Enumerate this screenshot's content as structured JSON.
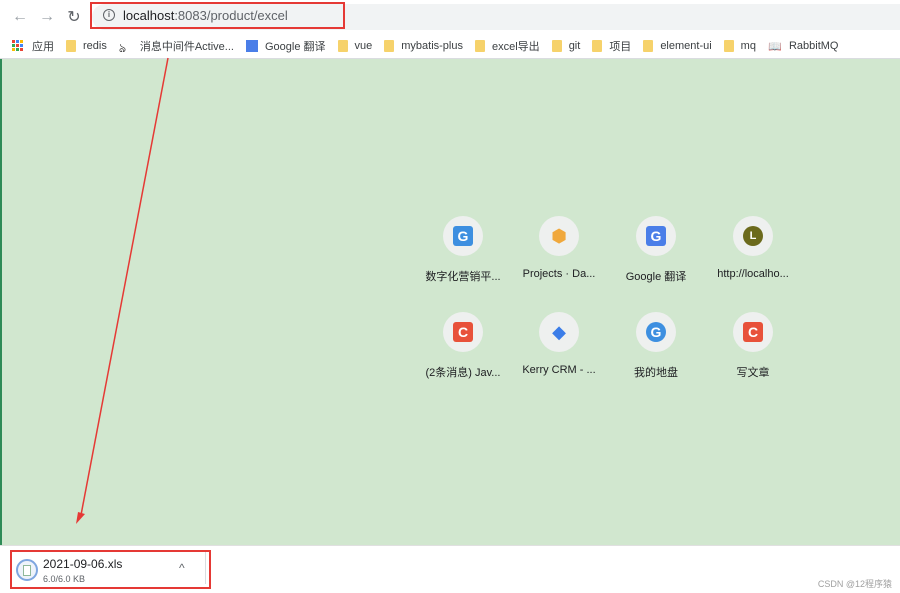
{
  "browser": {
    "nav": {
      "back_icon": "←",
      "forward_icon": "→",
      "reload_icon": "↻"
    },
    "address_bar": {
      "info_icon": "i",
      "host": "localhost",
      "rest": ":8083/product/excel"
    },
    "bookmarks": [
      {
        "label": "应用",
        "icon": "apps-icon"
      },
      {
        "label": "redis",
        "icon": "folder-icon"
      },
      {
        "label": "消息中间件Active...",
        "icon": "activemq-icon"
      },
      {
        "label": "Google 翻译",
        "icon": "google-translate-icon"
      },
      {
        "label": "vue",
        "icon": "folder-icon"
      },
      {
        "label": "mybatis-plus",
        "icon": "folder-icon"
      },
      {
        "label": "excel导出",
        "icon": "folder-icon"
      },
      {
        "label": "git",
        "icon": "folder-icon"
      },
      {
        "label": "项目",
        "icon": "folder-icon"
      },
      {
        "label": "element-ui",
        "icon": "folder-icon"
      },
      {
        "label": "mq",
        "icon": "folder-icon"
      },
      {
        "label": "RabbitMQ",
        "icon": "book-icon"
      }
    ]
  },
  "shortcuts": [
    {
      "label": "数字化营销平...",
      "icon": "marketing-platform-icon",
      "glyph": "G",
      "color": "#3d8fe0"
    },
    {
      "label": "Projects · Da...",
      "icon": "projects-icon",
      "glyph": "⬢",
      "color": "#f0a83c"
    },
    {
      "label": "Google 翻译",
      "icon": "google-translate-icon",
      "glyph": "G",
      "color": "#4a7ee8"
    },
    {
      "label": "http://localho...",
      "icon": "letter-l-icon",
      "glyph": "L",
      "color": "#6b6a1c"
    },
    {
      "label": "(2条消息) Jav...",
      "icon": "csdn-icon",
      "glyph": "C",
      "color": "#e8513a"
    },
    {
      "label": "Kerry CRM - ...",
      "icon": "jira-icon",
      "glyph": "◆",
      "color": "#3b7de8"
    },
    {
      "label": "我的地盘",
      "icon": "cloud-disk-icon",
      "glyph": "G",
      "color": "#3d8fe0"
    },
    {
      "label": "写文章",
      "icon": "csdn-icon",
      "glyph": "C",
      "color": "#e8513a"
    }
  ],
  "download": {
    "filename": "2021-09-06.xls",
    "size": "6.0/6.0 KB",
    "chevron": "^"
  },
  "watermark": "CSDN @12程序猿",
  "colors": {
    "annotation": "#e53935",
    "page_bg": "#d1e7cf"
  }
}
